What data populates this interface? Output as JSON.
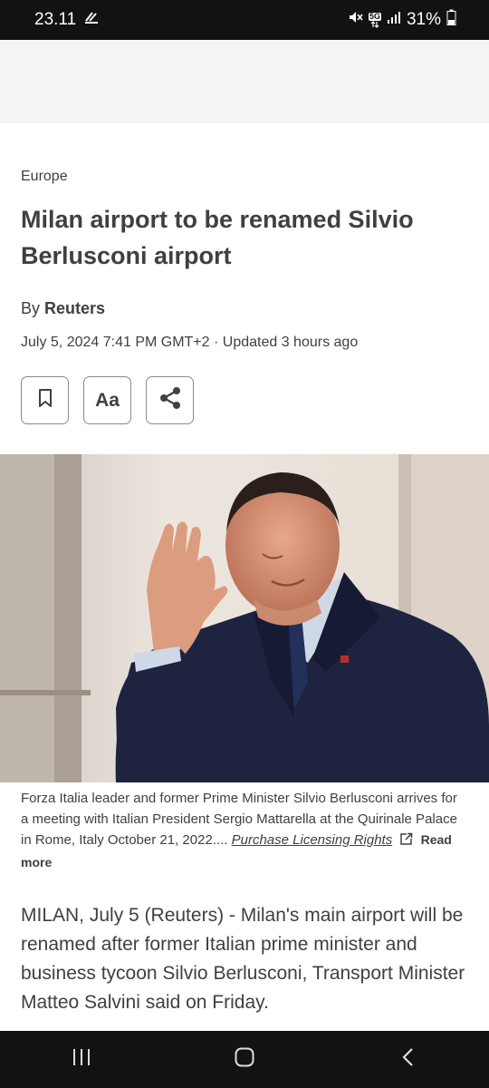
{
  "status_bar": {
    "time": "23.11",
    "battery": "31%",
    "network": "5G"
  },
  "article": {
    "section": "Europe",
    "headline": "Milan airport to be renamed Silvio Berlusconi airport",
    "byline_prefix": "By",
    "byline_author": "Reuters",
    "dateline": "July 5, 2024 7:41 PM GMT+2 · Updated 3 hours ago",
    "actions": {
      "bookmark_icon": "bookmark-icon",
      "text_size_label": "Aa",
      "share_icon": "share-icon"
    },
    "image": {
      "caption": "Forza Italia leader and former Prime Minister Silvio Berlusconi arrives for a meeting with Italian President Sergio Mattarella at the Quirinale Palace in Rome, Italy October 21, 2022....",
      "licensing_link": "Purchase Licensing Rights",
      "read_more": "Read more"
    },
    "body_first_paragraph": "MILAN, July 5 (Reuters) - Milan's main airport will be renamed after former Italian prime minister and business tycoon Silvio Berlusconi, Transport Minister Matteo Salvini said on Friday."
  },
  "nav_bar": {
    "recents_icon": "recents-icon",
    "home_icon": "home-icon",
    "back_icon": "back-icon"
  },
  "colors": {
    "text": "#404040",
    "system_bar": "#121212",
    "ad_background": "#f4f4f4"
  }
}
